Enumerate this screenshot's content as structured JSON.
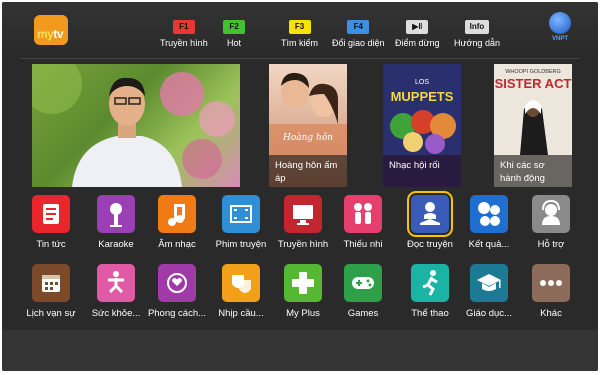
{
  "logo": {
    "text_my": "my",
    "text_tv": "tv"
  },
  "fkeys": [
    {
      "key": "F1",
      "label": "Truyền hình",
      "color": "#e53935"
    },
    {
      "key": "F2",
      "label": "Hot",
      "color": "#43c02e"
    },
    {
      "key": "F3",
      "label": "Tìm kiếm",
      "color": "#f5e400"
    },
    {
      "key": "F4",
      "label": "Đổi giao diện",
      "color": "#3d8fe0"
    },
    {
      "key": "▶‖",
      "label": "Điểm dừng",
      "color": "#dddddd"
    },
    {
      "key": "Info",
      "label": "Hướng dẫn",
      "color": "#dddddd"
    }
  ],
  "brand": "VNPT",
  "posters": [
    {
      "title": "Hoàng hôn ấm áp",
      "img_text": "Hoàng hôn"
    },
    {
      "title": "Nhạc hội rối",
      "img_text": "MUPPETS",
      "img_sub": "LOS"
    },
    {
      "title": "Khi các sơ hành động",
      "img_text": "SISTER ACT",
      "img_sub": "WHOOPI GOLDBERG"
    }
  ],
  "apps_row1": [
    {
      "label": "Tin tức",
      "color": "#e8262b",
      "icon": "news-icon"
    },
    {
      "label": "Karaoke",
      "color": "#9b3fb5",
      "icon": "microphone-icon"
    },
    {
      "label": "Âm nhạc",
      "color": "#f07a14",
      "icon": "music-note-icon"
    },
    {
      "label": "Phim truyện",
      "color": "#2e8fd6",
      "icon": "film-icon"
    },
    {
      "label": "Truyền hình",
      "color": "#c3262f",
      "icon": "tv-icon"
    },
    {
      "label": "Thiếu nhi",
      "color": "#e63e6d",
      "icon": "children-icon"
    },
    {
      "label": "Đọc truyện",
      "color": "#3b5bb8",
      "icon": "reading-icon"
    },
    {
      "label": "Kết quả...",
      "color": "#1e6fcf",
      "icon": "lottery-balls-icon"
    },
    {
      "label": "Hỗ trợ",
      "color": "#8a8a8a",
      "icon": "support-icon"
    }
  ],
  "apps_row2": [
    {
      "label": "Lịch vạn sự",
      "color": "#7b4a2a",
      "icon": "calendar-icon"
    },
    {
      "label": "Sức khỏe...",
      "color": "#e05aa6",
      "icon": "yoga-icon"
    },
    {
      "label": "Phong cách...",
      "color": "#a03aa8",
      "icon": "style-icon"
    },
    {
      "label": "Nhịp cầu...",
      "color": "#f29f1a",
      "icon": "theater-masks-icon"
    },
    {
      "label": "My Plus",
      "color": "#55b833",
      "icon": "plus-icon"
    },
    {
      "label": "Games",
      "color": "#2ea04a",
      "icon": "gamepad-icon"
    },
    {
      "label": "Thể thao",
      "color": "#1bb3a3",
      "icon": "running-icon"
    },
    {
      "label": "Giáo dục...",
      "color": "#1d7a94",
      "icon": "graduation-cap-icon"
    },
    {
      "label": "Khác",
      "color": "#8d6b5a",
      "icon": "more-icon"
    }
  ]
}
